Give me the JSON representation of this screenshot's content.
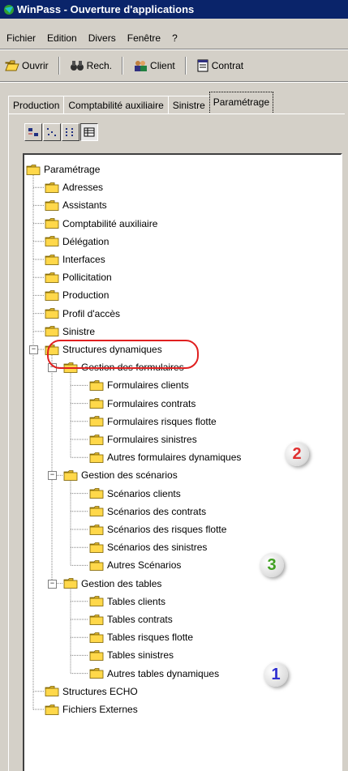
{
  "window": {
    "title": "WinPass - Ouverture d'applications"
  },
  "menu": [
    "Fichier",
    "Edition",
    "Divers",
    "Fenêtre",
    "?"
  ],
  "toolbar": [
    {
      "label": "Ouvrir",
      "icon": "open-folder-icon"
    },
    {
      "label": "Rech.",
      "icon": "binoculars-icon"
    },
    {
      "label": "Client",
      "icon": "client-icon"
    },
    {
      "label": "Contrat",
      "icon": "contract-icon"
    }
  ],
  "tabs": [
    "Production",
    "Comptabilité auxiliaire",
    "Sinistre",
    "Paramétrage"
  ],
  "active_tab": "Paramétrage",
  "view_buttons": [
    "large-icons-view",
    "small-icons-view",
    "list-view",
    "details-view"
  ],
  "tree": {
    "root": "Paramétrage",
    "level1": [
      "Adresses",
      "Assistants",
      "Comptabilité auxiliaire",
      "Délégation",
      "Interfaces",
      "Pollicitation",
      "Production",
      "Profil d'accès",
      "Sinistre"
    ],
    "structures": "Structures dynamiques",
    "formulaires": {
      "label": "Gestion des formulaires",
      "items": [
        "Formulaires clients",
        "Formulaires contrats",
        "Formulaires risques flotte",
        "Formulaires sinistres",
        "Autres formulaires dynamiques"
      ]
    },
    "scenarios": {
      "label": "Gestion des scénarios",
      "items": [
        "Scénarios clients",
        "Scénarios des contrats",
        "Scénarios des risques flotte",
        "Scénarios des sinistres",
        "Autres Scénarios"
      ]
    },
    "tables": {
      "label": "Gestion des tables",
      "items": [
        "Tables clients",
        "Tables contrats",
        "Tables risques flotte",
        "Tables sinistres",
        "Autres tables dynamiques"
      ]
    },
    "tail": [
      "Structures ECHO",
      "Fichiers Externes"
    ]
  },
  "badges": {
    "one": "1",
    "two": "2",
    "three": "3"
  },
  "colors": {
    "title_bg": "#0a246a",
    "folder": "#ffd84a",
    "highlight": "#e02020",
    "badge1": "#3030d0",
    "badge2": "#e03030",
    "badge3": "#40a020"
  }
}
